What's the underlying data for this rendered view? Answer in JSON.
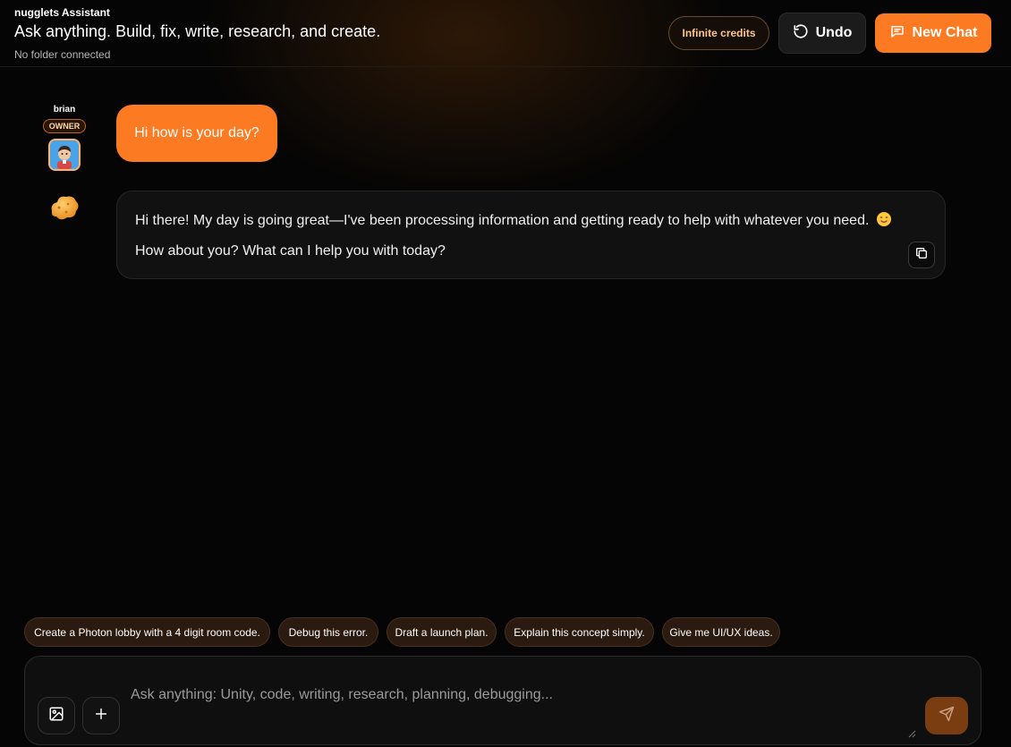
{
  "header": {
    "app_name": "nugglets Assistant",
    "tagline": "Ask anything. Build, fix, write, research, and create.",
    "folder_status": "No folder connected",
    "credits_label": "Infinite credits",
    "undo_label": "Undo",
    "new_chat_label": "New Chat"
  },
  "user": {
    "name": "brian",
    "role_badge": "OWNER"
  },
  "messages": [
    {
      "role": "user",
      "text": "Hi how is your day?"
    },
    {
      "role": "assistant",
      "line1": "Hi there! My day is going great—I've been processing information and getting ready to help with whatever you need.",
      "line2": "How about you? What can I help you with today?"
    }
  ],
  "suggestions": [
    "Create a Photon lobby with a 4 digit room code.",
    "Debug this error.",
    "Draft a launch plan.",
    "Explain this concept simply.",
    "Give me UI/UX ideas."
  ],
  "composer": {
    "placeholder": "Ask anything: Unity, code, writing, research, planning, debugging..."
  },
  "icons": {
    "undo": "undo-icon",
    "new_chat": "chat-bubble-icon",
    "copy": "copy-icon",
    "image": "image-icon",
    "add": "plus-icon",
    "send": "send-icon"
  },
  "colors": {
    "accent": "#fb7a22",
    "background": "#050505",
    "bubble": "#111111"
  }
}
